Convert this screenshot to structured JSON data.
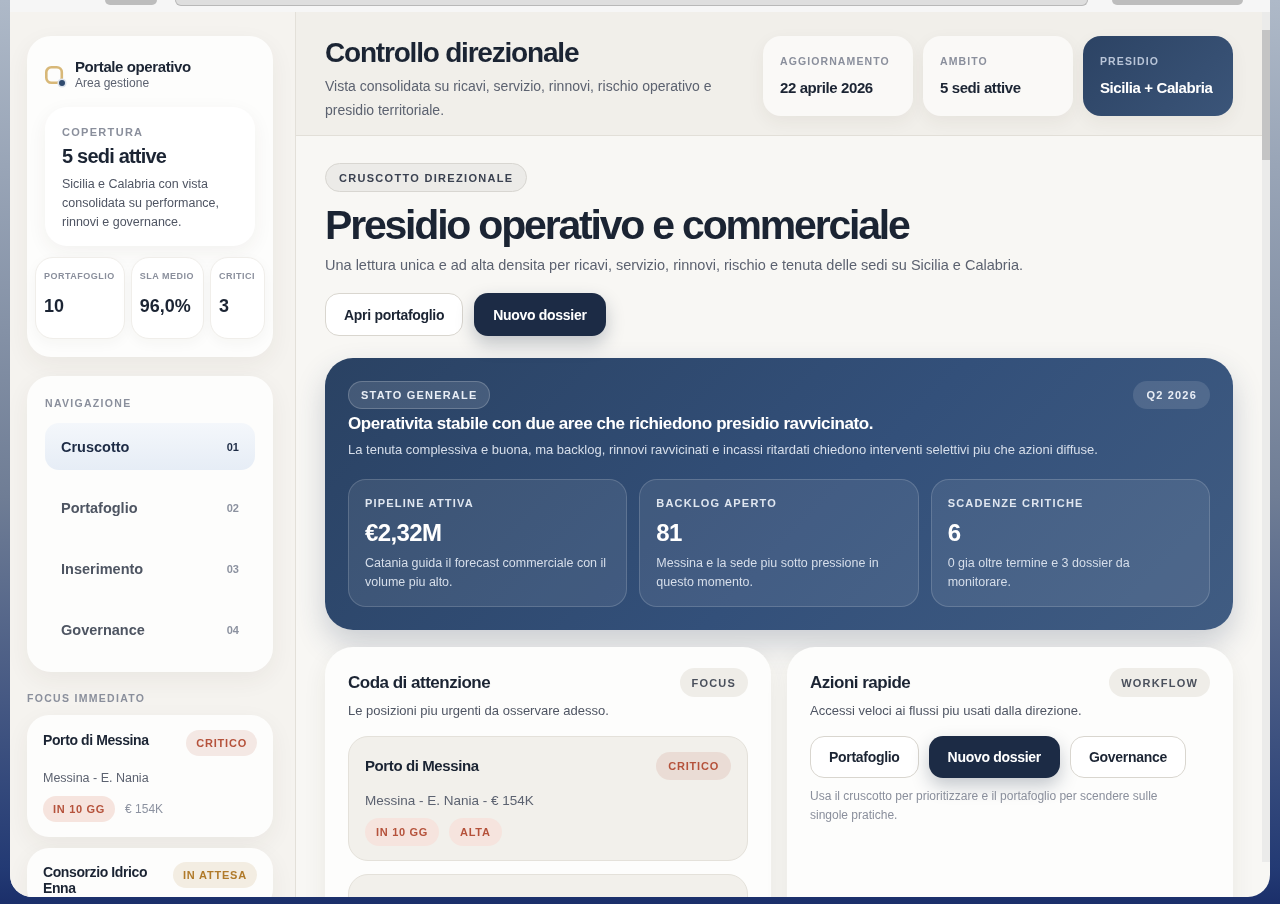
{
  "sidebar": {
    "brand": {
      "title": "Portale operativo",
      "subtitle": "Area gestione"
    },
    "coverage": {
      "label": "COPERTURA",
      "value": "5 sedi attive",
      "description": "Sicilia e Calabria con vista consolidata su performance, rinnovi e governance."
    },
    "stats": [
      {
        "label": "PORTAFOGLIO",
        "value": "10"
      },
      {
        "label": "SLA MEDIO",
        "value": "96,0%"
      },
      {
        "label": "CRITICI",
        "value": "3"
      }
    ],
    "navigation": {
      "title": "NAVIGAZIONE",
      "items": [
        {
          "label": "Cruscotto",
          "number": "01",
          "selected": true
        },
        {
          "label": "Portafoglio",
          "number": "02",
          "selected": false
        },
        {
          "label": "Inserimento",
          "number": "03",
          "selected": false
        },
        {
          "label": "Governance",
          "number": "04",
          "selected": false
        }
      ]
    },
    "focus": {
      "title": "FOCUS IMMEDIATO",
      "items": [
        {
          "name": "Porto di Messina",
          "status": {
            "label": "CRITICO",
            "color": "#b5523b"
          },
          "meta": "Messina - E. Nania",
          "due": "IN 10 GG",
          "amount": "€ 154K"
        },
        {
          "name": "Consorzio Idrico Enna",
          "status": {
            "label": "IN ATTESA",
            "color": "#b07a2a"
          }
        }
      ]
    }
  },
  "header": {
    "title": "Controllo direzionale",
    "subtitle": "Vista consolidata su ricavi, servizio, rinnovi, rischio operativo e presidio territoriale.",
    "info_cards": [
      {
        "label": "AGGIORNAMENTO",
        "value": "22 aprile 2026",
        "highlighted": false
      },
      {
        "label": "AMBITO",
        "value": "5 sedi attive",
        "highlighted": false
      },
      {
        "label": "PRESIDIO",
        "value": "Sicilia + Calabria",
        "highlighted": true
      }
    ]
  },
  "hero": {
    "eyebrow": "CRUSCOTTO DIREZIONALE",
    "title": "Presidio operativo e commerciale",
    "description": "Una lettura unica e ad alta densita per ricavi, servizio, rinnovi, rischio e tenuta delle sedi su Sicilia e Calabria.",
    "buttons": [
      {
        "label": "Apri portafoglio",
        "kind": "secondary"
      },
      {
        "label": "Nuovo dossier",
        "kind": "primary"
      }
    ]
  },
  "status_panel": {
    "badge": "STATO GENERALE",
    "period": "Q2 2026",
    "title": "Operativita stabile con due aree che richiedono presidio ravvicinato.",
    "description": "La tenuta complessiva e buona, ma backlog, rinnovi ravvicinati e incassi ritardati chiedono interventi selettivi piu che azioni diffuse.",
    "metrics": [
      {
        "label": "PIPELINE ATTIVA",
        "value": "€2,32M",
        "description": "Catania guida il forecast commerciale con il volume piu alto."
      },
      {
        "label": "BACKLOG APERTO",
        "value": "81",
        "description": "Messina e la sede piu sotto pressione in questo momento."
      },
      {
        "label": "SCADENZE CRITICHE",
        "value": "6",
        "description": "0 gia oltre termine e 3 dossier da monitorare."
      }
    ]
  },
  "attention_queue": {
    "title": "Coda di attenzione",
    "badge": "FOCUS",
    "subtitle": "Le posizioni piu urgenti da osservare adesso.",
    "items": [
      {
        "name": "Porto di Messina",
        "status": {
          "label": "CRITICO",
          "color": "#b5523b"
        },
        "meta": "Messina - E. Nania - € 154K",
        "tags": [
          "IN 10 GG",
          "ALTA"
        ]
      }
    ]
  },
  "quick_actions": {
    "title": "Azioni rapide",
    "badge": "WORKFLOW",
    "subtitle": "Accessi veloci ai flussi piu usati dalla direzione.",
    "buttons": [
      {
        "label": "Portafoglio",
        "kind": "secondary"
      },
      {
        "label": "Nuovo dossier",
        "kind": "primary"
      },
      {
        "label": "Governance",
        "kind": "secondary"
      }
    ],
    "hint": "Usa il cruscotto per prioritizzare e il portafoglio per scendere sulle singole pratiche."
  }
}
